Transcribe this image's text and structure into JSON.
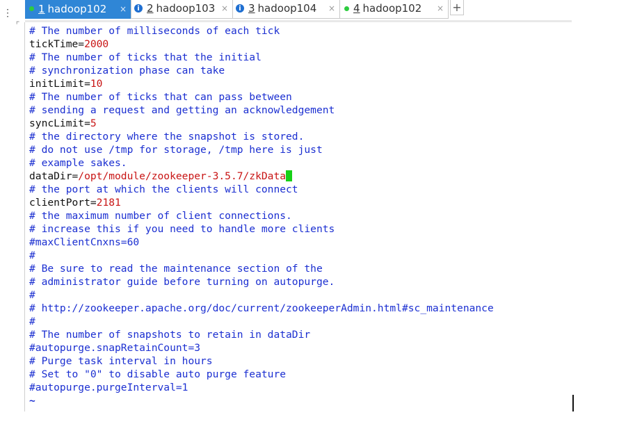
{
  "tabs": [
    {
      "number": "1",
      "host": "hadoop102",
      "status_color": "#2ecc40",
      "status": "dot",
      "active": true
    },
    {
      "number": "2",
      "host": "hadoop103",
      "status_color": "#1f6fd1",
      "status": "info",
      "active": false
    },
    {
      "number": "3",
      "host": "hadoop104",
      "status_color": "#1f6fd1",
      "status": "info",
      "active": false
    },
    {
      "number": "4",
      "host": "hadoop102",
      "status_color": "#2ecc40",
      "status": "dot",
      "active": false
    }
  ],
  "add_tab_label": "+",
  "close_glyph": "×",
  "editor": {
    "lines": [
      {
        "type": "comment",
        "text": "# The number of milliseconds of each tick"
      },
      {
        "type": "kv",
        "key": "tickTime=",
        "value": "2000"
      },
      {
        "type": "comment",
        "text": "# The number of ticks that the initial"
      },
      {
        "type": "comment",
        "text": "# synchronization phase can take"
      },
      {
        "type": "kv",
        "key": "initLimit=",
        "value": "10"
      },
      {
        "type": "comment",
        "text": "# The number of ticks that can pass between"
      },
      {
        "type": "comment",
        "text": "# sending a request and getting an acknowledgement"
      },
      {
        "type": "kv",
        "key": "syncLimit=",
        "value": "5"
      },
      {
        "type": "comment",
        "text": "# the directory where the snapshot is stored."
      },
      {
        "type": "comment",
        "text": "# do not use /tmp for storage, /tmp here is just"
      },
      {
        "type": "comment",
        "text": "# example sakes."
      },
      {
        "type": "kv",
        "key": "dataDir=",
        "value": "/opt/module/zookeeper-3.5.7/zkData",
        "cursor": true
      },
      {
        "type": "comment",
        "text": "# the port at which the clients will connect"
      },
      {
        "type": "kv",
        "key": "clientPort=",
        "value": "2181"
      },
      {
        "type": "comment",
        "text": "# the maximum number of client connections."
      },
      {
        "type": "comment",
        "text": "# increase this if you need to handle more clients"
      },
      {
        "type": "comment",
        "text": "#maxClientCnxns=60"
      },
      {
        "type": "comment",
        "text": "#"
      },
      {
        "type": "comment",
        "text": "# Be sure to read the maintenance section of the"
      },
      {
        "type": "comment",
        "text": "# administrator guide before turning on autopurge."
      },
      {
        "type": "comment",
        "text": "#"
      },
      {
        "type": "comment",
        "text": "# http://zookeeper.apache.org/doc/current/zookeeperAdmin.html#sc_maintenance"
      },
      {
        "type": "comment",
        "text": "#"
      },
      {
        "type": "comment",
        "text": "# The number of snapshots to retain in dataDir"
      },
      {
        "type": "comment",
        "text": "#autopurge.snapRetainCount=3"
      },
      {
        "type": "comment",
        "text": "# Purge task interval in hours"
      },
      {
        "type": "comment",
        "text": "# Set to \"0\" to disable auto purge feature"
      },
      {
        "type": "comment",
        "text": "#autopurge.purgeInterval=1"
      },
      {
        "type": "tilde",
        "text": "~"
      }
    ]
  },
  "colors": {
    "comment": "#1b2fd1",
    "value": "#c81414",
    "active_tab": "#2f86d6",
    "cursor": "#17d117"
  },
  "icons": {
    "menu": "vertical-dots-menu-icon",
    "tab_status_active": "green-dot-icon",
    "tab_status_info": "info-icon"
  }
}
